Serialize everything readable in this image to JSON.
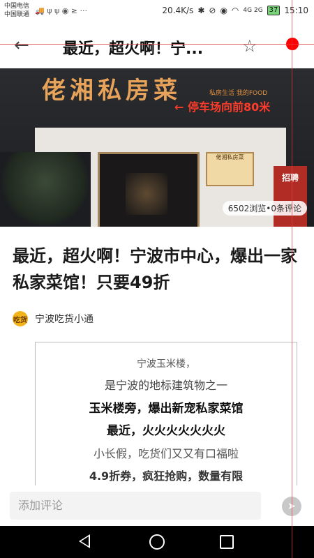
{
  "status": {
    "carrier1": "中国电信",
    "carrier2": "中国联通",
    "left_icons": "🚚 ψ ψ ◉ ≥ ···",
    "speed": "20.4K/s",
    "signal": "4G 2G",
    "battery": "37",
    "time": "15:10"
  },
  "topbar": {
    "back_icon": "arrow-left-icon",
    "title": "最近，超火啊！宁...",
    "star_icon": "star-outline-icon"
  },
  "hero": {
    "sign": "佬湘私房菜",
    "sign_sub": "私房生活 我的FOOD",
    "parking": "← 停车场向前80米",
    "board": "佬湘私房菜",
    "recruit": "招聘",
    "views": "6502浏览•0条评论"
  },
  "article": {
    "headline": "最近，超火啊！宁波市中心，爆出一家私家菜馆！只要49折",
    "author": "宁波吃货小通",
    "avatar_text": "吃货"
  },
  "card": {
    "line1": "宁波玉米楼，",
    "line2": "是宁波的地标建筑物之一",
    "line3": "玉米楼旁，爆出新宠私家菜馆",
    "line4": "最近，火火火火火火火",
    "line5": "小长假，吃货们又又有口福啦",
    "line6": "4.9折券，疯狂抢购，数量有限"
  },
  "comment": {
    "placeholder": "添加评论",
    "send_icon": "send-icon"
  },
  "colors": {
    "accent_red": "#ff0000",
    "sign_orange": "#e7a35a"
  }
}
